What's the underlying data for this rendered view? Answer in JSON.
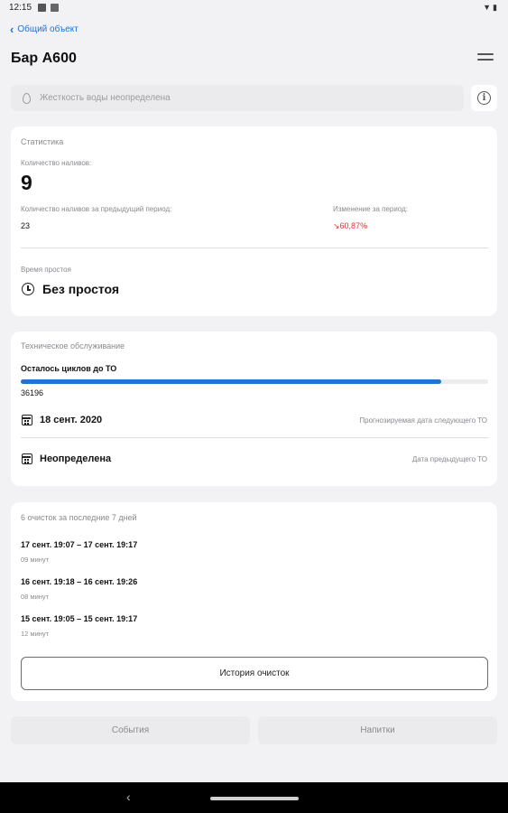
{
  "status_bar": {
    "time": "12:15",
    "left_icons": [
      "notification-icon",
      "photo-icon"
    ],
    "right_icons": [
      "wifi-icon",
      "battery-icon"
    ]
  },
  "nav": {
    "back_label": "Общий объект"
  },
  "page": {
    "title": "Бар А600"
  },
  "water": {
    "text": "Жесткость воды неопределена"
  },
  "stats": {
    "section_title": "Статистика",
    "pours_label": "Количество наливов:",
    "pours_value": "9",
    "prev_label": "Количество наливов за предыдущий период:",
    "prev_value": "23",
    "change_label": "Изменение за период:",
    "change_value": "↘60,87%",
    "downtime_label": "Время простоя",
    "downtime_value": "Без простоя"
  },
  "maintenance": {
    "section_title": "Техническое обслуживание",
    "cycles_label": "Осталось циклов до ТО",
    "cycles_value": "36196",
    "progress_fraction": 0.9,
    "next_date": "18 сент. 2020",
    "next_date_label": "Прогнозируемая дата следующего ТО",
    "prev_date": "Неопределена",
    "prev_date_label": "Дата предыдущего ТО"
  },
  "cleanings": {
    "section_title": "6 очисток за последние 7 дней",
    "items": [
      {
        "range": "17 сент. 19:07 – 17 сент. 19:17",
        "duration": "09 минут"
      },
      {
        "range": "16 сент. 19:18 – 16 сент. 19:26",
        "duration": "08 минут"
      },
      {
        "range": "15 сент. 19:05 – 15 сент. 19:17",
        "duration": "12 минут"
      }
    ],
    "history_button": "История очисток"
  },
  "tabs": {
    "events": "События",
    "drinks": "Напитки"
  },
  "colors": {
    "accent": "#1f74d6",
    "negative": "#e0303a",
    "background": "#f2f2f4"
  }
}
